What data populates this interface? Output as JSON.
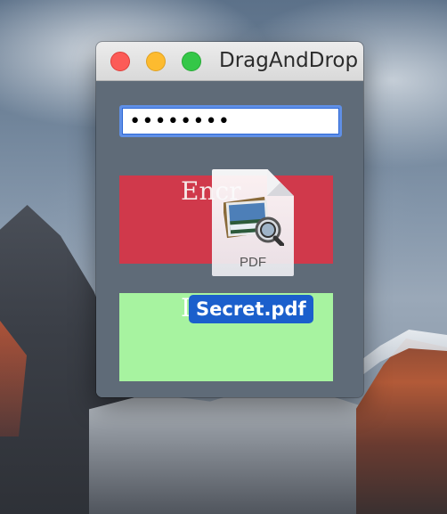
{
  "window": {
    "title": "DragAndDrop"
  },
  "password_field": {
    "value": "••••••••"
  },
  "zones": {
    "encrypt_label": "Encr",
    "decrypt_label": "I"
  },
  "dragged_file": {
    "type_label": "PDF",
    "name": "Secret.pdf"
  },
  "colors": {
    "encrypt_zone": "#d0394b",
    "decrypt_zone": "#a7f3a0",
    "window_bg": "#5f6b78",
    "selection": "#1b5fcc"
  },
  "icons": {
    "file": "preview-pdf-icon",
    "close": "close-button-red",
    "minimize": "minimize-button-yellow",
    "zoom": "zoom-button-green"
  }
}
